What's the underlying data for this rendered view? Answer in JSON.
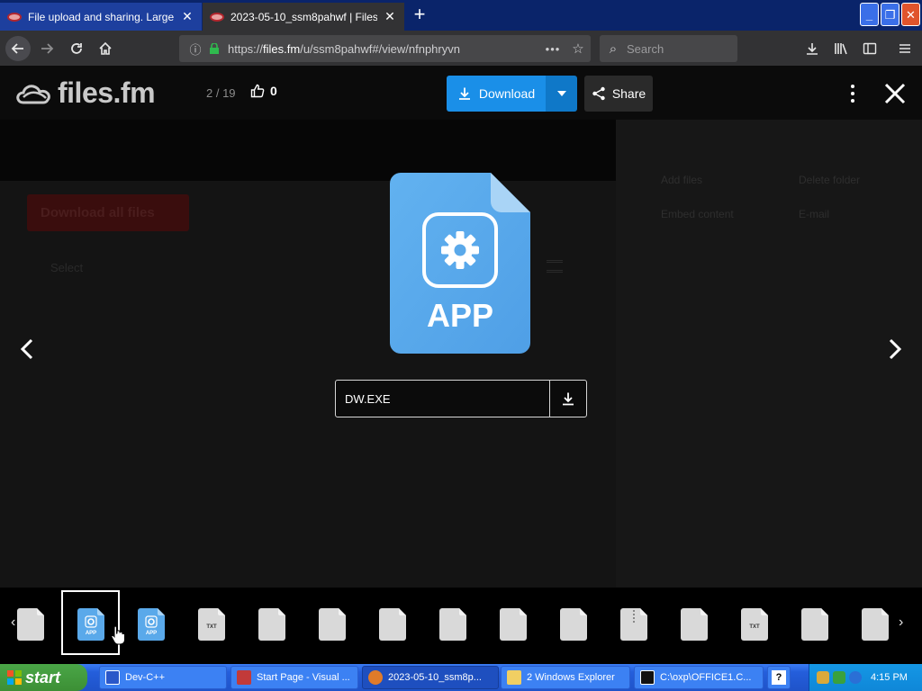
{
  "browser": {
    "tabs": [
      {
        "title": "File upload and sharing. Large file",
        "close": "✕"
      },
      {
        "title": "2023-05-10_ssm8pahwf | Files.fm",
        "close": "✕"
      }
    ],
    "new_tab": "+",
    "url_prefix": "https://",
    "url_domain": "files.fm",
    "url_path": "/u/ssm8pahwf#/view/nfnphryvn",
    "search_placeholder": "Search",
    "window_buttons": {
      "minimize": "_",
      "maximize": "❐",
      "close": "✕"
    }
  },
  "viewer": {
    "logo_text": "files.fm",
    "counter": "2 / 19",
    "likes": "0",
    "download_label": "Download",
    "share_label": "Share",
    "filename": "DW.EXE",
    "icon_label": "APP"
  },
  "background_page": {
    "download_all": "Download all files",
    "select_all": "Select",
    "actions": [
      "Add files",
      "Delete folder",
      "Embed content",
      "E-mail"
    ]
  },
  "thumbnails": [
    {
      "type": "blank"
    },
    {
      "type": "app",
      "label": "APP"
    },
    {
      "type": "app",
      "label": "APP"
    },
    {
      "type": "txt",
      "label": "TXT"
    },
    {
      "type": "blank"
    },
    {
      "type": "blank"
    },
    {
      "type": "blank"
    },
    {
      "type": "blank"
    },
    {
      "type": "blank"
    },
    {
      "type": "blank"
    },
    {
      "type": "zip"
    },
    {
      "type": "blank"
    },
    {
      "type": "txt",
      "label": "TXT"
    },
    {
      "type": "blank"
    },
    {
      "type": "blank"
    }
  ],
  "taskbar": {
    "start_label": "start",
    "tasks": [
      {
        "label": "Dev-C++"
      },
      {
        "label": "Start Page - Visual ..."
      },
      {
        "label": "2023-05-10_ssm8p..."
      },
      {
        "label": "2 Windows Explorer"
      },
      {
        "label": "C:\\oxp\\OFFICE1.C..."
      },
      {
        "label": "?"
      }
    ],
    "clock": "4:15 PM"
  },
  "colors": {
    "accent_blue": "#1a8fe8",
    "app_icon_blue": "#5aa9ea",
    "viewer_bg": "#0b0b0b",
    "taskbar_blue": "#245edb"
  }
}
